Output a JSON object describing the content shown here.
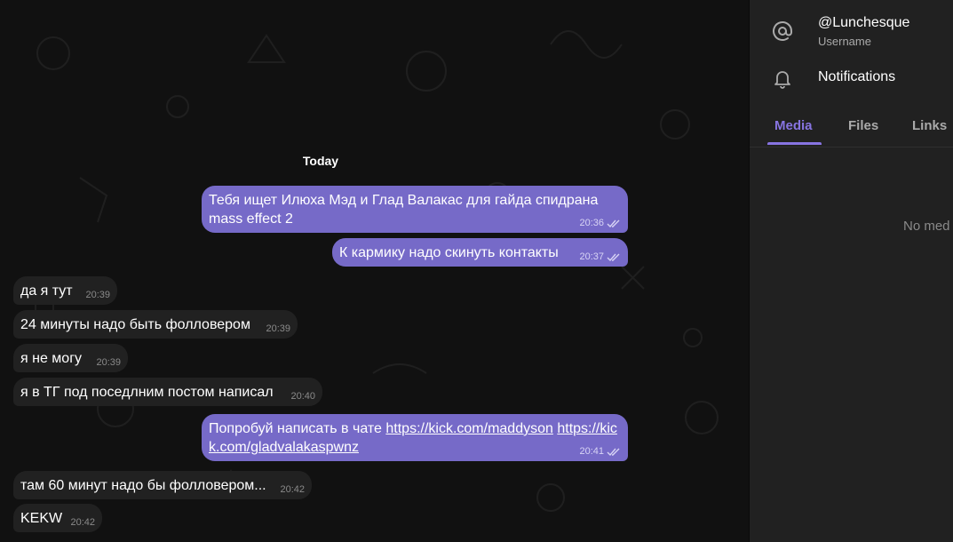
{
  "chat": {
    "date_separator": "Today",
    "messages": [
      {
        "direction": "out",
        "text": "Тебя ищет Илюха Мэд и Глад Валакас для гайда спидрана mass effect 2",
        "time": "20:36",
        "read": true
      },
      {
        "direction": "out",
        "text": "К кармику надо скинуть контакты",
        "time": "20:37",
        "read": true
      },
      {
        "direction": "in",
        "text": "да я тут",
        "time": "20:39"
      },
      {
        "direction": "in",
        "text": "24 минуты надо быть фолловером",
        "time": "20:39"
      },
      {
        "direction": "in",
        "text": "я не могу",
        "time": "20:39"
      },
      {
        "direction": "in",
        "text": "я в ТГ под поседлним постом написал",
        "time": "20:40"
      },
      {
        "direction": "out",
        "text_prefix": "Попробуй написать в чате ",
        "link1": "https://kick.com/maddyson",
        "link2": "https://kick.com/gladvalakaspwnz",
        "time": "20:41",
        "read": true
      },
      {
        "direction": "in",
        "text": "там 60 минут надо бы фолловером...",
        "time": "20:42"
      },
      {
        "direction": "in",
        "text": "KEKW",
        "time": "20:42"
      }
    ]
  },
  "sidebar": {
    "username": {
      "value": "@Lunchesque",
      "label": "Username",
      "icon": "at-icon"
    },
    "notifications": {
      "label": "Notifications",
      "icon": "bell-icon"
    },
    "tabs": [
      {
        "label": "Media",
        "active": true
      },
      {
        "label": "Files",
        "active": false
      },
      {
        "label": "Links",
        "active": false
      }
    ],
    "empty_text": "No med"
  },
  "colors": {
    "chat_background": "#111111",
    "incoming_bubble": "#212121",
    "outgoing_bubble": "#766ac8",
    "accent": "#8774e1",
    "sidebar_background": "#212121"
  }
}
